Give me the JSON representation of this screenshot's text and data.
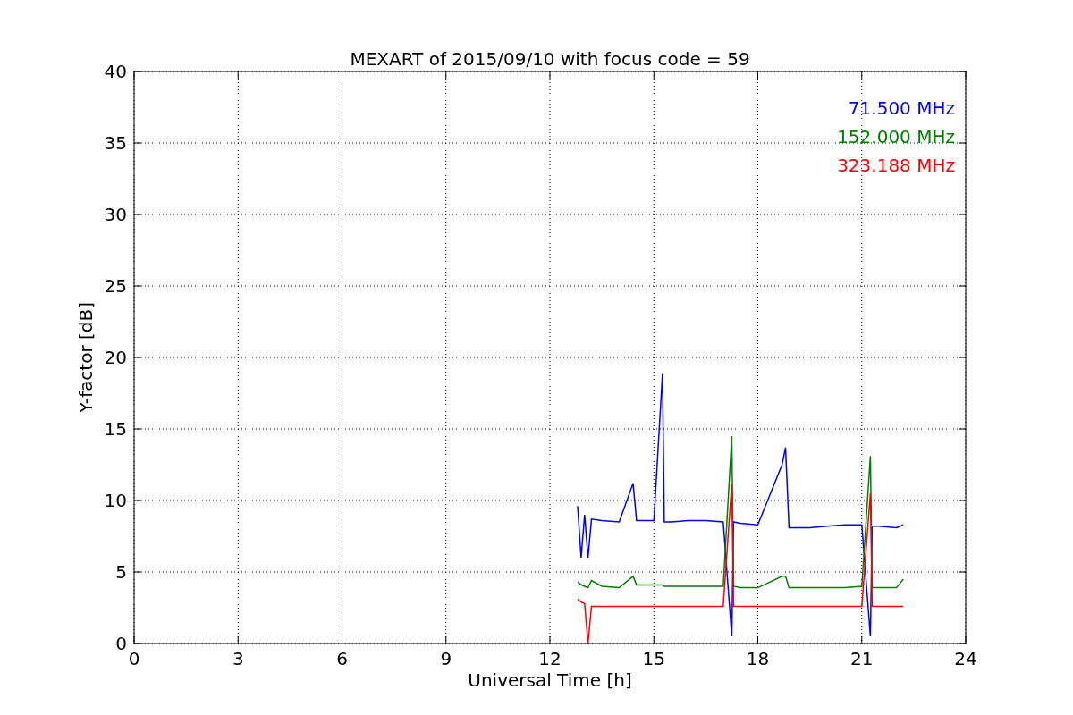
{
  "figure": {
    "chart_data": {
      "type": "line",
      "title": "MEXART of 2015/09/10 with focus code = 59",
      "xlabel": "Universal Time [h]",
      "ylabel": "Y-factor [dB]",
      "xlim": [
        0,
        24
      ],
      "ylim": [
        0,
        40
      ],
      "xticks": [
        0,
        3,
        6,
        9,
        12,
        15,
        18,
        21,
        24
      ],
      "yticks": [
        0,
        5,
        10,
        15,
        20,
        25,
        30,
        35,
        40
      ],
      "grid": true,
      "x": [
        12.8,
        12.9,
        13.0,
        13.1,
        13.2,
        13.5,
        14.0,
        14.4,
        14.5,
        15.0,
        15.25,
        15.3,
        15.5,
        16.0,
        16.5,
        17.0,
        17.25,
        17.3,
        17.5,
        18.0,
        18.7,
        18.8,
        18.9,
        19.5,
        20.0,
        20.5,
        21.0,
        21.25,
        21.3,
        21.5,
        22.0,
        22.2
      ],
      "series": [
        {
          "name": "71.500 MHz",
          "color": "#0000ff",
          "values": [
            9.6,
            6.0,
            9.0,
            6.0,
            8.7,
            8.6,
            8.5,
            11.2,
            8.6,
            8.6,
            18.9,
            8.5,
            8.5,
            8.6,
            8.6,
            8.5,
            0.5,
            8.5,
            8.4,
            8.3,
            12.5,
            13.7,
            8.1,
            8.1,
            8.2,
            8.3,
            8.3,
            0.5,
            8.2,
            8.2,
            8.1,
            8.3
          ]
        },
        {
          "name": "152.000 MHz",
          "color": "#008000",
          "values": [
            4.3,
            4.1,
            4.0,
            3.9,
            4.4,
            4.0,
            3.9,
            4.7,
            4.1,
            4.1,
            4.1,
            4.0,
            4.0,
            4.0,
            4.0,
            4.0,
            14.5,
            4.0,
            3.9,
            3.9,
            4.7,
            4.7,
            3.9,
            3.9,
            3.9,
            3.9,
            4.0,
            13.1,
            3.9,
            3.9,
            3.9,
            4.5
          ]
        },
        {
          "name": "323.188 MHz",
          "color": "#ff0000",
          "values": [
            3.1,
            2.9,
            2.8,
            0,
            2.6,
            2.6,
            2.6,
            2.6,
            2.6,
            2.6,
            2.6,
            2.6,
            2.6,
            2.6,
            2.6,
            2.6,
            11.2,
            2.6,
            2.6,
            2.6,
            2.6,
            2.6,
            2.6,
            2.6,
            2.6,
            2.6,
            2.6,
            10.5,
            2.6,
            2.6,
            2.6,
            2.6
          ]
        }
      ]
    }
  }
}
